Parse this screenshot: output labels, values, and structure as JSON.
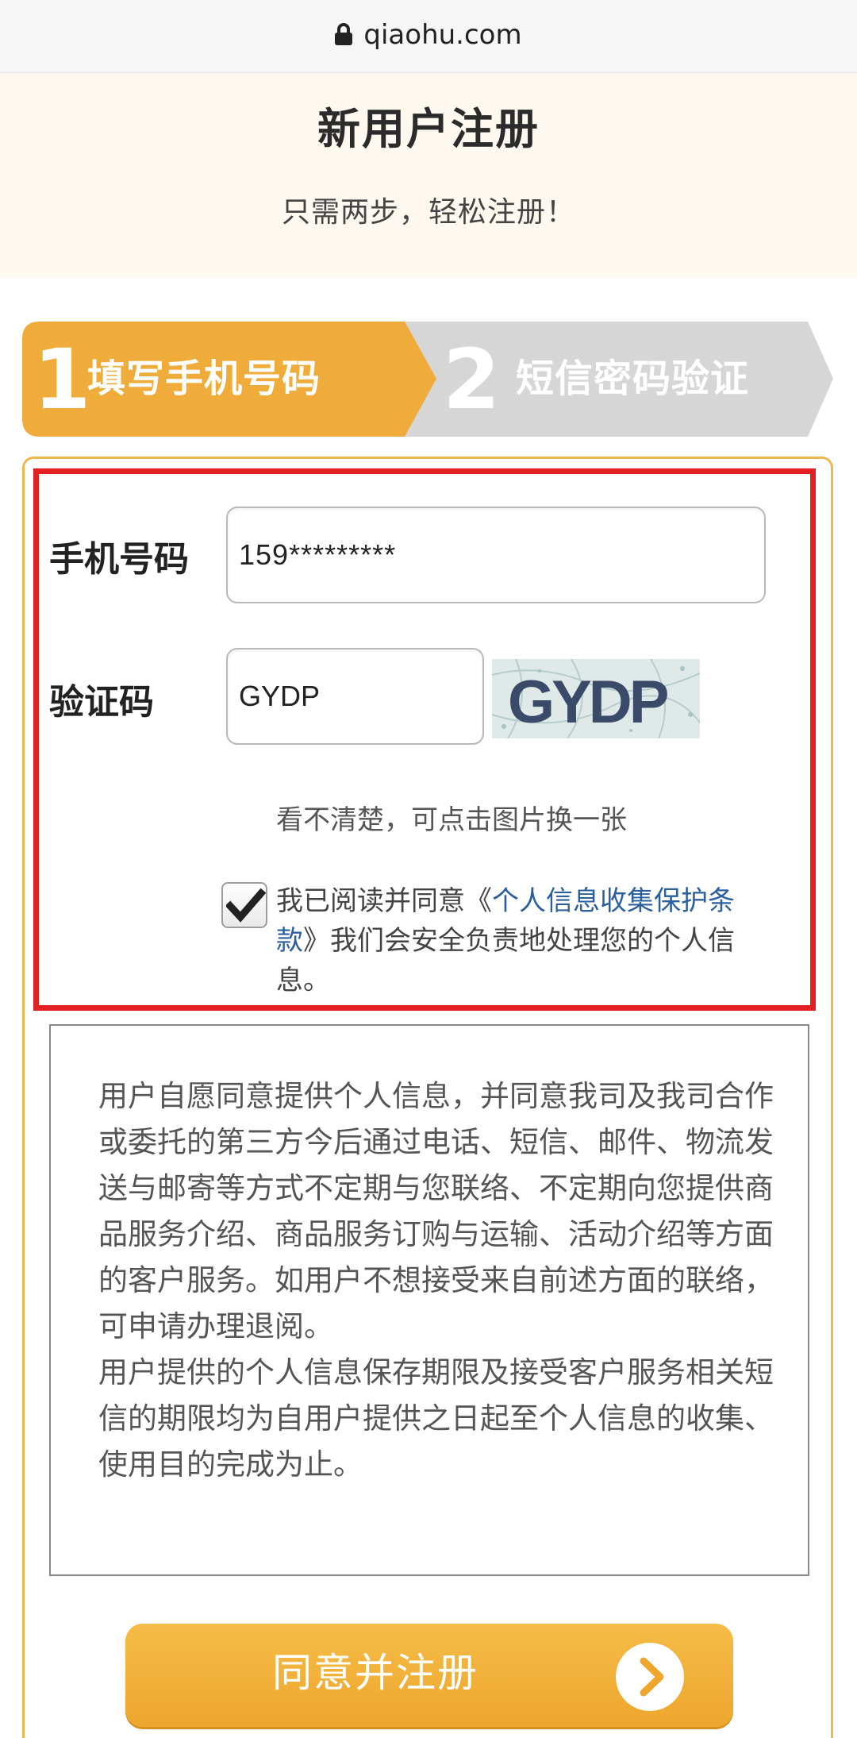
{
  "browser": {
    "url": "qiaohu.com",
    "lock_icon": "lock-icon"
  },
  "header": {
    "title": "新用户注册",
    "subtitle": "只需两步，轻松注册！"
  },
  "steps": [
    {
      "number": "1",
      "label": "填写手机号码",
      "state": "active",
      "color": "#f0ac3a"
    },
    {
      "number": "2",
      "label": "短信密码验证",
      "state": "inactive",
      "color": "#d6d6d6"
    }
  ],
  "form": {
    "phone_label": "手机号码",
    "phone_value": "159*********",
    "captcha_label": "验证码",
    "captcha_value": "GYDP",
    "captcha_image_text": "GYDP",
    "captcha_hint": "看不清楚，可点击图片换一张",
    "agree_checked": true,
    "agree_prefix": "我已阅读并同意《",
    "agree_link": "个人信息收集保护条款",
    "agree_suffix": "》我们会安全负责地处理您的个人信息。"
  },
  "consent": {
    "paragraph1": "用户自愿同意提供个人信息，并同意我司及我司合作或委托的第三方今后通过电话、短信、邮件、物流发送与邮寄等方式不定期与您联络、不定期向您提供商品服务介绍、商品服务订购与运输、活动介绍等方面的客户服务。如用户不想接受来自前述方面的联络，可申请办理退阅。",
    "paragraph2": "用户提供的个人信息保存期限及接受客户服务相关短信的期限均为自用户提供之日起至个人信息的收集、使用目的完成为止。"
  },
  "submit": {
    "label": "同意并注册",
    "icon": "chevron-right-icon"
  },
  "colors": {
    "accent": "#f0ac3a",
    "highlight_border": "#e32021",
    "link": "#2a5fa0"
  }
}
